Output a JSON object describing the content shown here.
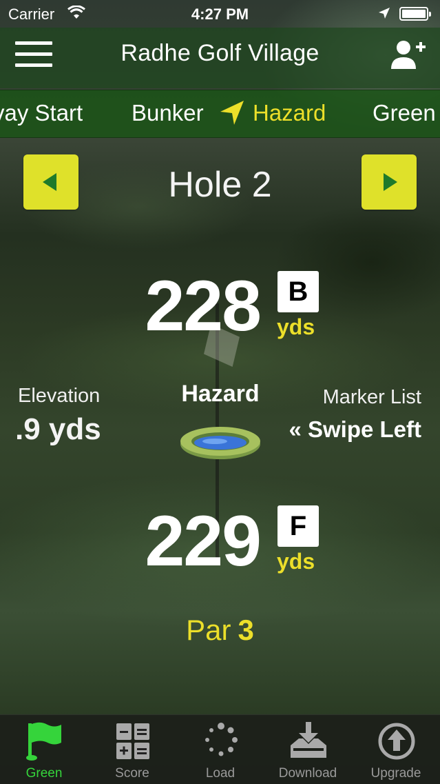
{
  "status_bar": {
    "carrier": "Carrier",
    "time": "4:27 PM"
  },
  "nav": {
    "title": "Radhe Golf Village"
  },
  "segments": {
    "items": [
      "vay Start",
      "Bunker",
      "Hazard",
      "Green"
    ],
    "active": "Hazard"
  },
  "hole": {
    "title": "Hole 2"
  },
  "distances": {
    "back": {
      "value": "228",
      "badge": "B",
      "unit": "yds"
    },
    "front": {
      "value": "229",
      "badge": "F",
      "unit": "yds"
    }
  },
  "elevation": {
    "label": "Elevation",
    "value": ".9 yds"
  },
  "target": {
    "label": "Hazard",
    "icon": "water-hazard-icon"
  },
  "marker_list": {
    "label": "Marker List",
    "hint": "« Swipe Left"
  },
  "par": {
    "label": "Par",
    "value": "3"
  },
  "tabs": [
    {
      "label": "Green",
      "icon": "flag-icon",
      "active": true
    },
    {
      "label": "Score",
      "icon": "scorecard-icon",
      "active": false
    },
    {
      "label": "Load",
      "icon": "loading-spinner-icon",
      "active": false
    },
    {
      "label": "Download",
      "icon": "download-tray-icon",
      "active": false
    },
    {
      "label": "Upgrade",
      "icon": "upgrade-arrow-icon",
      "active": false
    }
  ],
  "colors": {
    "accent_yellow": "#ECDF2A",
    "active_green": "#35D43B",
    "bar_green": "#1A5416"
  }
}
